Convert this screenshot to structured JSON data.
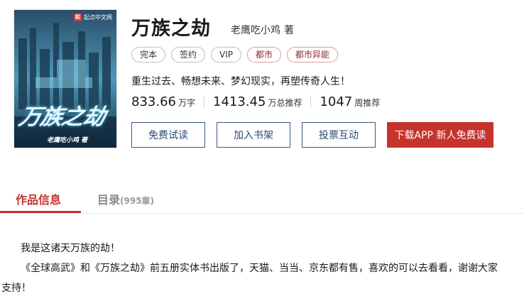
{
  "book": {
    "cover": {
      "badge_text": "起点中文网",
      "badge_logo": "起",
      "title_text": "万族之劫",
      "author_text": "老鹰吃小鸡 著"
    },
    "title": "万族之劫",
    "author": "老鹰吃小鸡",
    "author_suffix": "著",
    "tags": [
      {
        "label": "完本",
        "style": "gray"
      },
      {
        "label": "签约",
        "style": "gray"
      },
      {
        "label": "VIP",
        "style": "gray"
      },
      {
        "label": "都市",
        "style": "red"
      },
      {
        "label": "都市异能",
        "style": "red"
      }
    ],
    "description": "重生过去、畅想未来、梦幻现实，再塑传奇人生！",
    "stats": [
      {
        "value": "833.66",
        "unit": "万字"
      },
      {
        "value": "1413.45",
        "unit": "万总推荐"
      },
      {
        "value": "1047",
        "unit": "周推荐"
      }
    ],
    "buttons": {
      "free_read": "免费试读",
      "add_shelf": "加入书架",
      "vote": "投票互动",
      "download": "下载APP 新人免费读"
    }
  },
  "tabs": {
    "info": "作品信息",
    "catalog": "目录",
    "catalog_count": "(995章)"
  },
  "intro": {
    "line1": "我是这诸天万族的劫！",
    "line2": "《全球高武》和《万族之劫》前五册实体书出版了，天猫、当当、京东都有售，喜欢的可以去看看，谢谢大家",
    "line3": "支持！"
  },
  "colors": {
    "accent": "#c6322c",
    "button_border": "#3b5a7f",
    "tag_red_border": "#e39a9a"
  }
}
